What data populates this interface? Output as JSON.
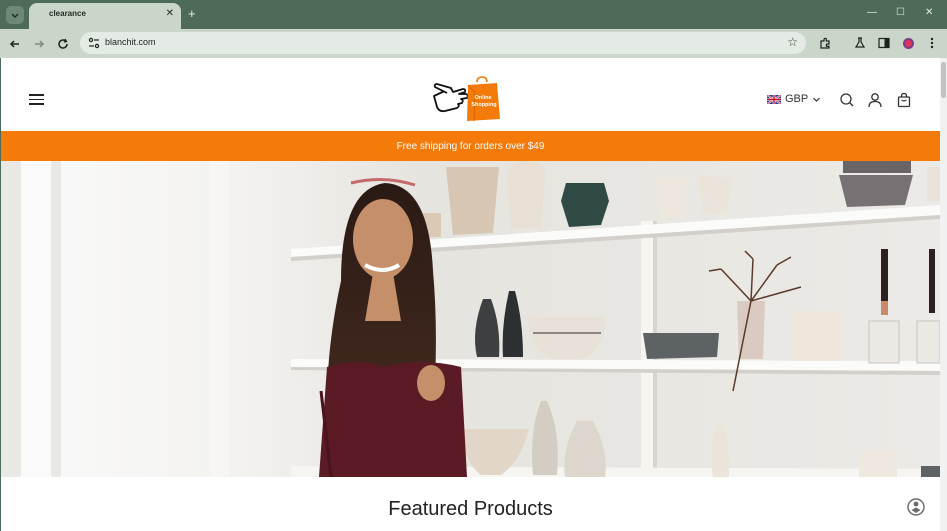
{
  "browser": {
    "tab_title": "clearance",
    "url": "blanchit.com"
  },
  "header": {
    "logo_text_line1": "Online",
    "logo_text_line2": "Shopping",
    "currency": "GBP"
  },
  "announcement": "Free shipping for orders over $49",
  "section_title": "Featured Products",
  "colors": {
    "accent": "#f47a0a",
    "browser_frame": "#4e6a58",
    "toolbar": "#c9d6c9"
  }
}
